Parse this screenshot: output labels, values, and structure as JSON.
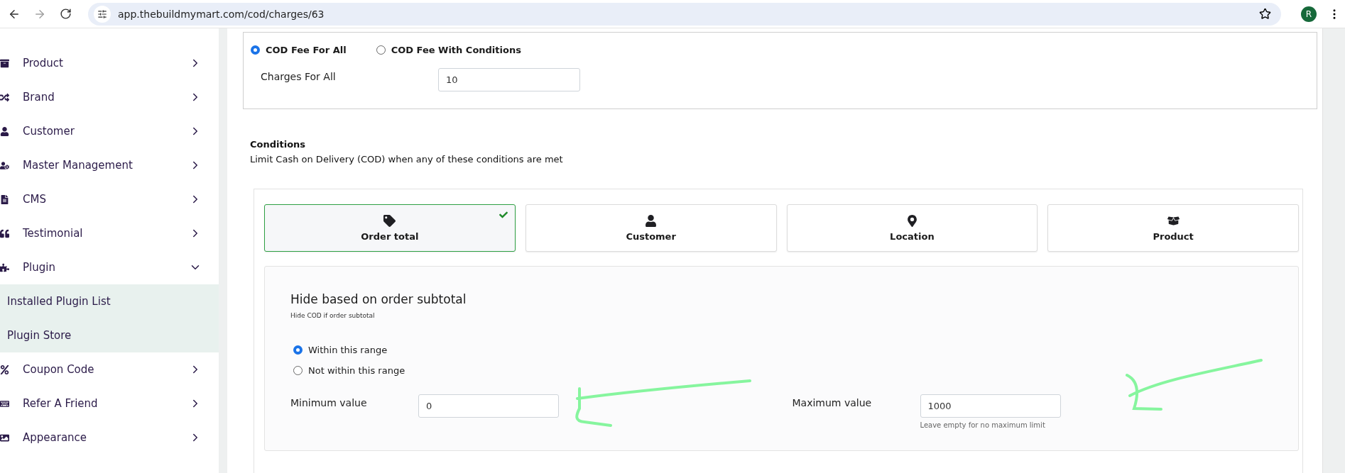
{
  "browser": {
    "url": "app.thebuildmymart.com/cod/charges/63",
    "avatar_initial": "R"
  },
  "sidebar": {
    "items": [
      {
        "label": "Product",
        "expanded": false
      },
      {
        "label": "Brand",
        "expanded": false
      },
      {
        "label": "Customer",
        "expanded": false
      },
      {
        "label": "Master Management",
        "expanded": false
      },
      {
        "label": "CMS",
        "expanded": false
      },
      {
        "label": "Testimonial",
        "expanded": false
      },
      {
        "label": "Plugin",
        "expanded": true,
        "children": [
          {
            "label": "Installed Plugin List"
          },
          {
            "label": "Plugin Store"
          }
        ]
      },
      {
        "label": "Coupon Code",
        "expanded": false
      },
      {
        "label": "Refer A Friend",
        "expanded": false
      },
      {
        "label": "Appearance",
        "expanded": false
      }
    ]
  },
  "fee_mode": [
    {
      "label": "COD Fee For All",
      "selected": true
    },
    {
      "label": "COD Fee With Conditions",
      "selected": false
    }
  ],
  "charges": {
    "label": "Charges For All",
    "value": "10"
  },
  "conditions": {
    "title": "Conditions",
    "subtitle": "Limit Cash on Delivery (COD) when any of these conditions are met"
  },
  "condition_tabs": [
    {
      "kind": "tag",
      "label": "Order total",
      "selected": true
    },
    {
      "kind": "person",
      "label": "Customer",
      "selected": false
    },
    {
      "kind": "pin",
      "label": "Location",
      "selected": false
    },
    {
      "kind": "box",
      "label": "Product",
      "selected": false
    }
  ],
  "panel": {
    "heading": "Hide based on order subtotal",
    "subtitle": "Hide COD if order subtotal",
    "range_options": [
      {
        "label": "Within this range",
        "selected": true
      },
      {
        "label": "Not within this range",
        "selected": false
      }
    ],
    "minimum": {
      "label": "Minimum value",
      "value": "0"
    },
    "maximum": {
      "label": "Maximum value",
      "value": "1000",
      "hint": "Leave empty for no maximum limit"
    }
  }
}
